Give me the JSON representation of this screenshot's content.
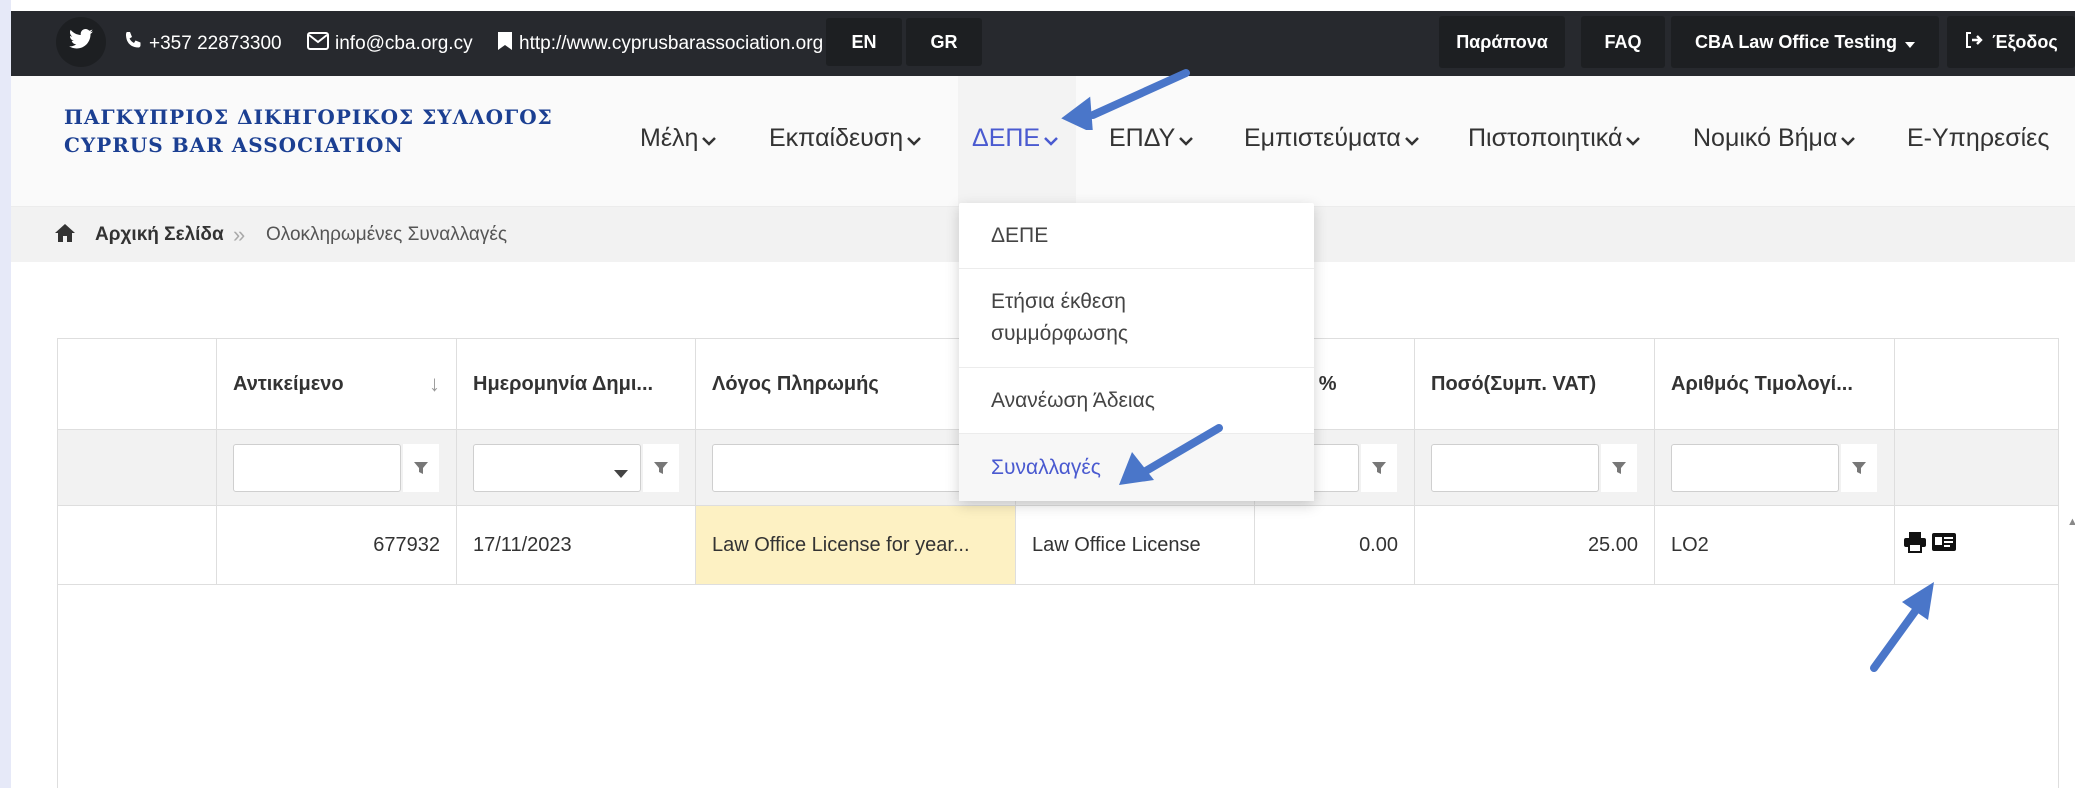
{
  "topbar": {
    "phone": "+357 22873300",
    "email": "info@cba.org.cy",
    "website": "http://www.cyprusbarassociation.org",
    "lang_en": "EN",
    "lang_gr": "GR",
    "complaints": "Παράπονα",
    "faq": "FAQ",
    "user": "CBA Law Office Testing",
    "logout": "Έξοδος"
  },
  "logo": {
    "line1": "ΠΑΓΚΥΠΡΙΟΣ ΔΙΚΗΓΟΡΙΚΟΣ ΣΥΛΛΟΓΟΣ",
    "line2": "CYPRUS BAR ASSOCIATION"
  },
  "nav": [
    {
      "label": "Μέλη"
    },
    {
      "label": "Εκπαίδευση"
    },
    {
      "label": "ΔΕΠΕ"
    },
    {
      "label": "ΕΠΔΥ"
    },
    {
      "label": "Εμπιστεύματα"
    },
    {
      "label": "Πιστοποιητικά"
    },
    {
      "label": "Νομικό Βήμα"
    },
    {
      "label": "Ε-Υπηρεσίες"
    }
  ],
  "dropdown": [
    {
      "label": "ΔΕΠΕ"
    },
    {
      "label": "Ετήσια έκθεση συμμόρφωσης"
    },
    {
      "label": "Ανανέωση Άδειας"
    },
    {
      "label": "Συναλλαγές"
    }
  ],
  "breadcrumb": {
    "home": "Αρχική Σελίδα",
    "current": "Ολοκληρωμένες Συναλλαγές"
  },
  "table": {
    "columns": [
      "",
      "Αντικείμενο",
      "Ημερομηνία Δημι...",
      "Λόγος Πληρωμής",
      "",
      "T %",
      "Ποσό(Συμπ. VAT)",
      "Αριθμός Τιμολογί...",
      ""
    ],
    "rows": [
      [
        "",
        "677932",
        "17/11/2023",
        "Law Office License for year...",
        "Law Office License",
        "0.00",
        "25.00",
        "LO2",
        ""
      ]
    ]
  },
  "colors": {
    "topbar_bg": "#27292e",
    "accent": "#4a5ad0",
    "logo_blue": "#1b3f92",
    "highlight": "#fdf1c3",
    "annotation_arrow": "#4a76c9"
  }
}
